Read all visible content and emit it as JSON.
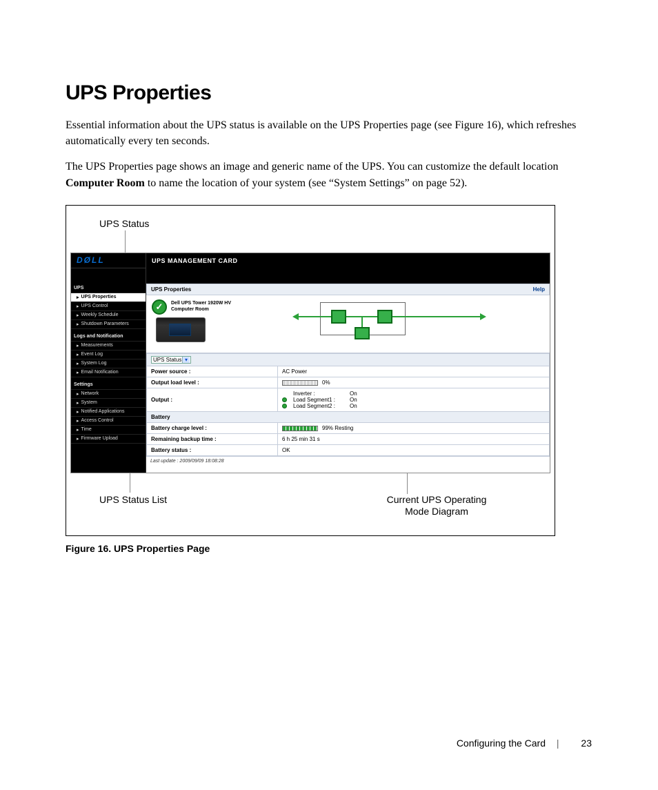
{
  "heading": "UPS Properties",
  "para1": "Essential information about the UPS status is available on the UPS Properties page (see Figure 16), which refreshes automatically every ten seconds.",
  "para2_a": "The UPS Properties page shows an image and generic name of the UPS. You can customize the default location ",
  "para2_bold": "Computer Room",
  "para2_b": " to name the location of your system (see “System Settings” on page 52).",
  "annot": {
    "ups_status": "UPS Status",
    "ups_status_list": "UPS Status List",
    "mode_diagram_l1": "Current UPS Operating",
    "mode_diagram_l2": "Mode Diagram"
  },
  "screenshot": {
    "logo": "DØLL",
    "mgmt_header": "UPS MANAGEMENT CARD",
    "panel_title": "UPS Properties",
    "help": "Help",
    "ups_name": "Dell UPS Tower 1920W HV",
    "ups_location": "Computer Room",
    "nav": {
      "group_ups": "UPS",
      "ups_properties": "UPS Properties",
      "ups_control": "UPS Control",
      "weekly_schedule": "Weekly Schedule",
      "shutdown_params": "Shutdown Parameters",
      "group_logs": "Logs and Notification",
      "measurements": "Measurements",
      "event_log": "Event Log",
      "system_log": "System Log",
      "email_notif": "Email Notification",
      "group_settings": "Settings",
      "network": "Network",
      "system": "System",
      "notified_apps": "Notified Applications",
      "access_control": "Access Control",
      "time": "Time",
      "firmware": "Firmware Upload"
    },
    "select_label": "UPS Status",
    "rows": {
      "power_source_k": "Power source :",
      "power_source_v": "AC Power",
      "output_load_k": "Output load level :",
      "output_load_v": "0%",
      "output_k": "Output :",
      "inverter_lbl": "Inverter :",
      "inverter_v": "On",
      "ls1_lbl": "Load Segment1 :",
      "ls1_v": "On",
      "ls2_lbl": "Load Segment2 :",
      "ls2_v": "On",
      "battery_hdr": "Battery",
      "charge_k": "Battery charge level :",
      "charge_v": "99%  Resting",
      "backup_k": "Remaining backup time :",
      "backup_v": "6 h 25 min 31 s",
      "status_k": "Battery status :",
      "status_v": "OK",
      "last_update": "Last update : 2009/09/09 18:08:28"
    }
  },
  "caption": "Figure 16. UPS Properties Page",
  "footer": {
    "section": "Configuring the Card",
    "page": "23"
  }
}
